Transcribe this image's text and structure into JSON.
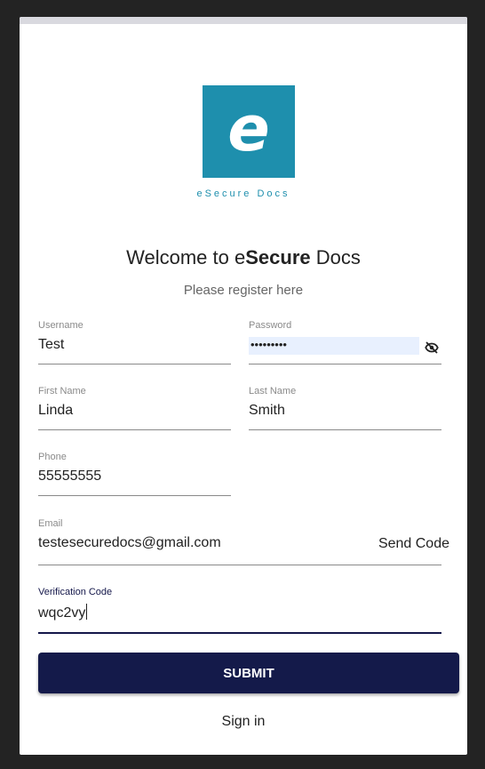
{
  "logo": {
    "letter": "e",
    "caption": "eSecure Docs"
  },
  "heading": {
    "prefix": "Welcome to e",
    "bold": "Secure",
    "suffix": " Docs"
  },
  "subheading": "Please register here",
  "form": {
    "username": {
      "label": "Username",
      "value": "Test"
    },
    "password": {
      "label": "Password",
      "value": "•••••••••"
    },
    "first_name": {
      "label": "First Name",
      "value": "Linda"
    },
    "last_name": {
      "label": "Last Name",
      "value": "Smith"
    },
    "phone": {
      "label": "Phone",
      "value": "55555555"
    },
    "email": {
      "label": "Email",
      "value": "testesecuredocs@gmail.com",
      "action": "Send Code"
    },
    "verification": {
      "label": "Verification Code",
      "value": "wqc2vy"
    }
  },
  "submit_label": "SUBMIT",
  "signin_label": "Sign in",
  "colors": {
    "brand": "#1e8fad",
    "primary": "#141a4a",
    "autofill": "#e8f0fe"
  }
}
